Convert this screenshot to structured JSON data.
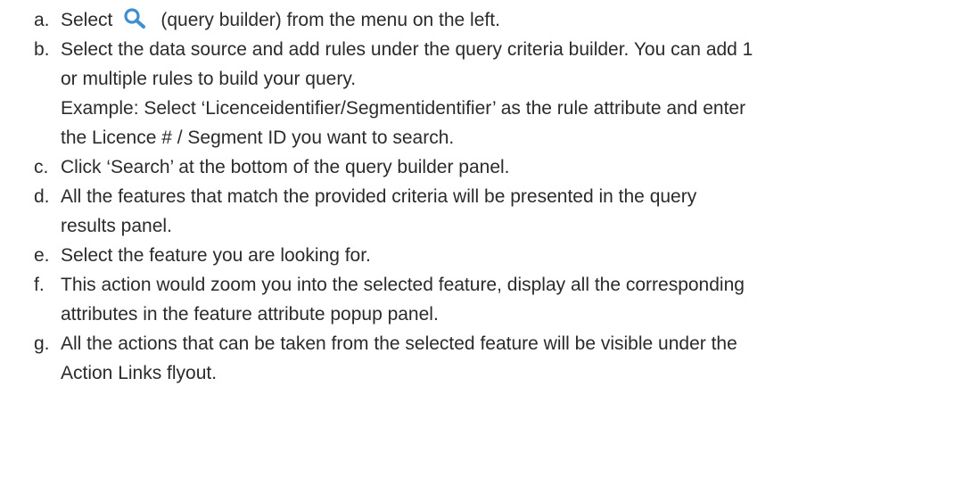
{
  "steps": [
    {
      "marker": "a.",
      "text_before_icon": "Select",
      "icon": "search-icon",
      "text_after_icon": "(query builder) from the menu on the left."
    },
    {
      "marker": "b.",
      "lines": [
        "Select the data source and add rules under the query criteria builder. You can add 1",
        "or multiple rules to build your query.",
        "Example:  Select ‘Licenceidentifier/Segmentidentifier’ as the rule attribute and enter",
        "the Licence #  / Segment ID you want to search."
      ]
    },
    {
      "marker": "c.",
      "lines": [
        "Click ‘Search’ at the bottom of the query builder panel."
      ]
    },
    {
      "marker": "d.",
      "lines": [
        "All the features that match the provided criteria will be presented in the query",
        "results panel."
      ]
    },
    {
      "marker": "e.",
      "lines": [
        "Select the feature you are looking for."
      ]
    },
    {
      "marker": "f.",
      "lines": [
        "This action would zoom you into the selected feature, display all the corresponding",
        "attributes in the feature attribute popup panel."
      ]
    },
    {
      "marker": "g.",
      "lines": [
        "All the actions that can be taken from the selected feature will be visible under the",
        "Action Links flyout."
      ]
    }
  ],
  "colors": {
    "text": "#2b2b2b",
    "icon_blue": "#3d8fd1"
  }
}
